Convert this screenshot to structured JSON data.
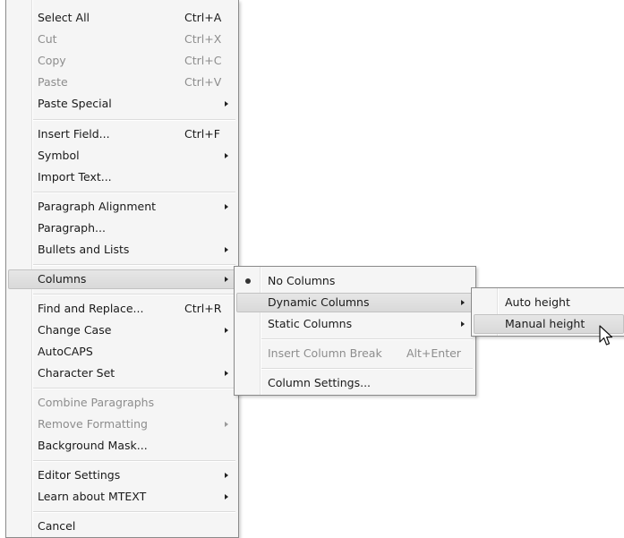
{
  "main_menu": {
    "items": [
      {
        "label": "Select All",
        "shortcut": "Ctrl+A"
      },
      {
        "label": "Cut",
        "shortcut": "Ctrl+X",
        "disabled": true
      },
      {
        "label": "Copy",
        "shortcut": "Ctrl+C",
        "disabled": true
      },
      {
        "label": "Paste",
        "shortcut": "Ctrl+V",
        "disabled": true
      },
      {
        "label": "Paste Special",
        "submenu": true
      },
      {
        "label": "Insert Field...",
        "shortcut": "Ctrl+F"
      },
      {
        "label": "Symbol",
        "submenu": true
      },
      {
        "label": "Import Text..."
      },
      {
        "label": "Paragraph Alignment",
        "submenu": true
      },
      {
        "label": "Paragraph..."
      },
      {
        "label": "Bullets and Lists",
        "submenu": true
      },
      {
        "label": "Columns",
        "submenu": true,
        "highlighted": true
      },
      {
        "label": "Find and Replace...",
        "shortcut": "Ctrl+R"
      },
      {
        "label": "Change Case",
        "submenu": true
      },
      {
        "label": "AutoCAPS"
      },
      {
        "label": "Character Set",
        "submenu": true
      },
      {
        "label": "Combine Paragraphs",
        "disabled": true
      },
      {
        "label": "Remove Formatting",
        "submenu": true,
        "disabled": true
      },
      {
        "label": "Background Mask..."
      },
      {
        "label": "Editor Settings",
        "submenu": true
      },
      {
        "label": "Learn about MTEXT",
        "submenu": true
      },
      {
        "label": "Cancel"
      }
    ]
  },
  "columns_menu": {
    "items": [
      {
        "label": "No Columns",
        "checked": true
      },
      {
        "label": "Dynamic Columns",
        "submenu": true,
        "highlighted": true
      },
      {
        "label": "Static Columns",
        "submenu": true
      },
      {
        "label": "Insert Column Break",
        "shortcut": "Alt+Enter",
        "disabled": true
      },
      {
        "label": "Column Settings..."
      }
    ]
  },
  "dynamic_menu": {
    "items": [
      {
        "label": "Auto height"
      },
      {
        "label": "Manual height",
        "highlighted": true
      }
    ]
  },
  "colors": {
    "menu_bg": "#f5f5f5",
    "border": "#8a8a8a",
    "disabled_text": "#8d8d8d",
    "highlight": "#dddddd"
  },
  "icons": {
    "radio": "radio-dot-icon",
    "submenu": "submenu-arrow-icon",
    "pointer": "mouse-pointer-icon"
  }
}
